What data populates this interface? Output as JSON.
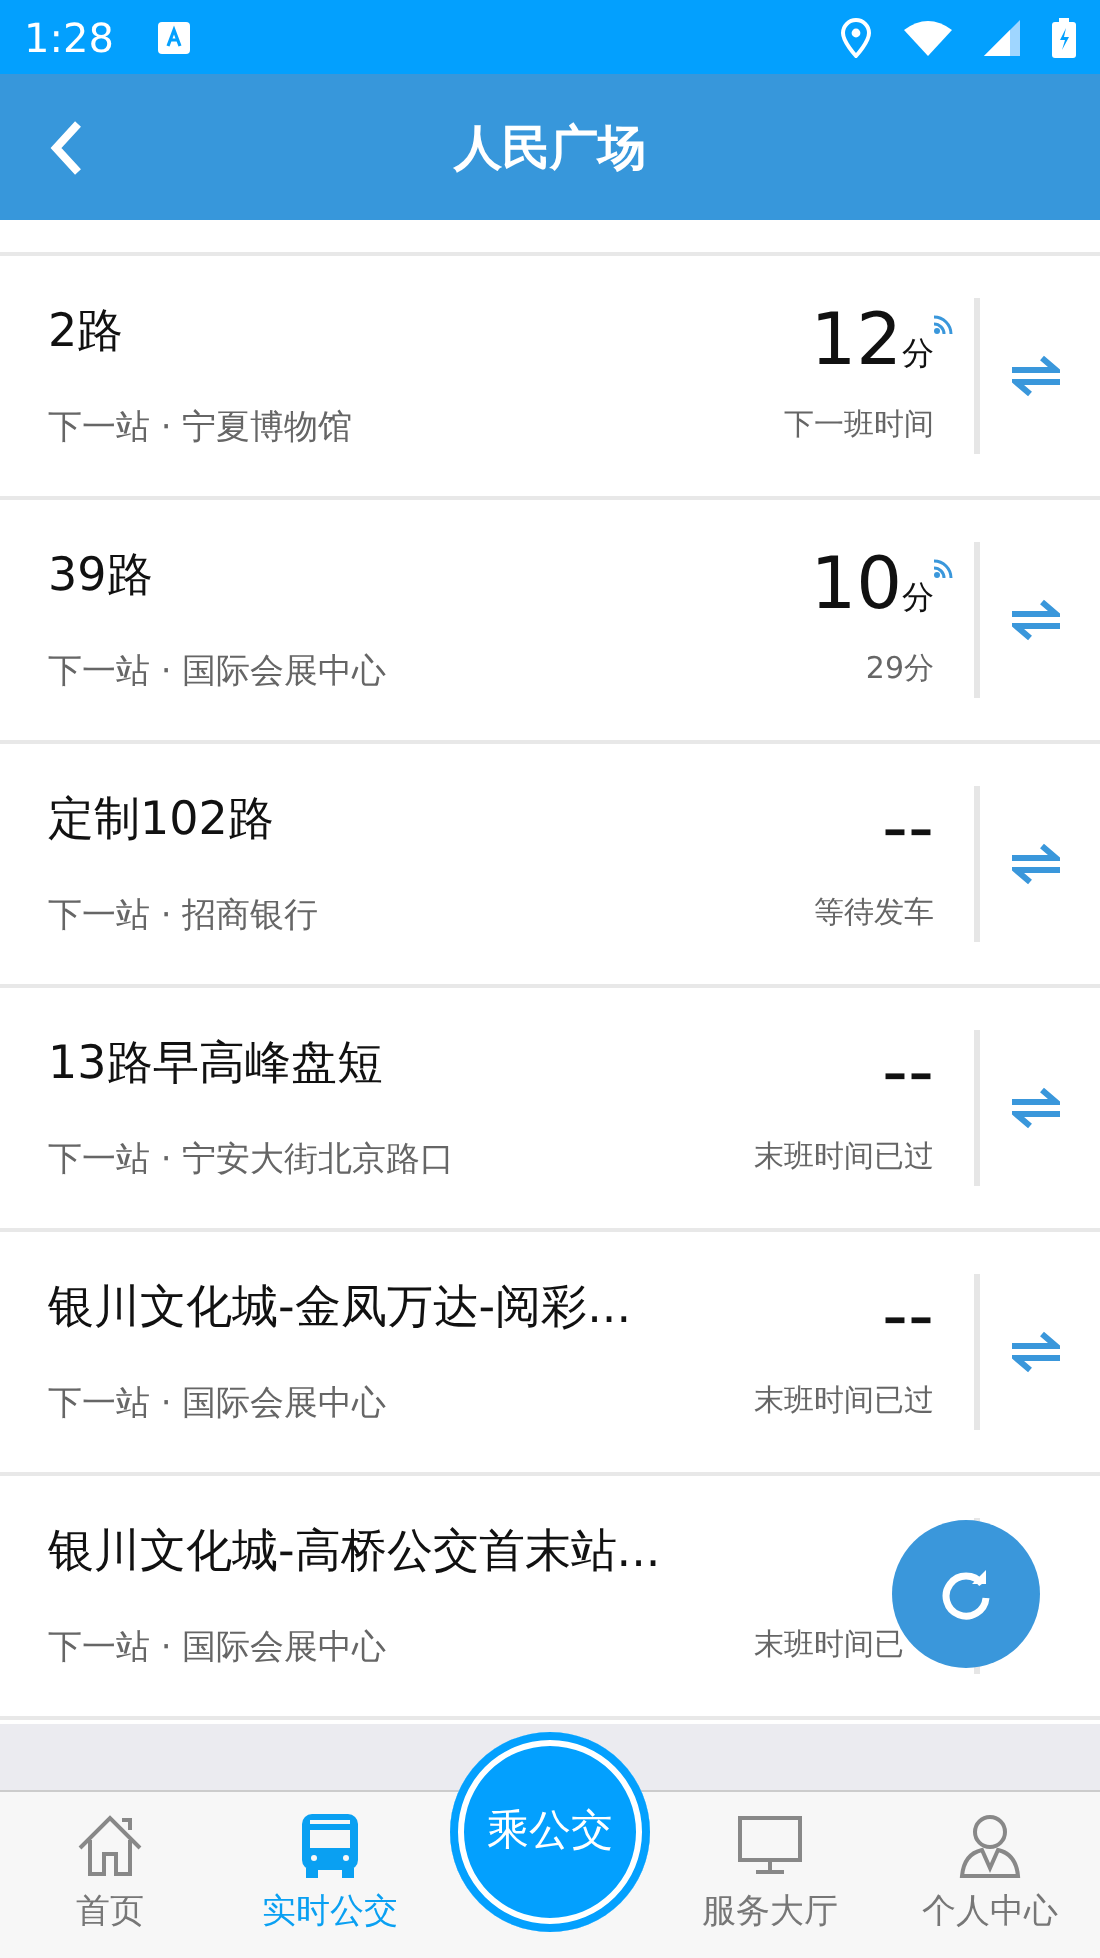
{
  "status_bar": {
    "time": "1:28"
  },
  "header": {
    "title": "人民广场"
  },
  "routes": [
    {
      "route": "2路",
      "next_stop": "下一站 · 宁夏博物馆",
      "eta": "12",
      "eta_unit": "分",
      "realtime": true,
      "status": "下一班时间"
    },
    {
      "route": "39路",
      "next_stop": "下一站 · 国际会展中心",
      "eta": "10",
      "eta_unit": "分",
      "realtime": true,
      "status": "29分"
    },
    {
      "route": "定制102路",
      "next_stop": "下一站 · 招商银行",
      "eta": "--",
      "realtime": false,
      "status": "等待发车"
    },
    {
      "route": "13路早高峰盘短",
      "next_stop": "下一站 · 宁安大街北京路口",
      "eta": "--",
      "realtime": false,
      "status": "末班时间已过"
    },
    {
      "route": "银川文化城-金凤万达-阅彩...",
      "next_stop": "下一站 · 国际会展中心",
      "eta": "--",
      "realtime": false,
      "status": "末班时间已过"
    },
    {
      "route": "银川文化城-高桥公交首末站...",
      "next_stop": "下一站 · 国际会展中心",
      "status": "末班时间已"
    }
  ],
  "nav": [
    {
      "kind": "home",
      "label": "首页",
      "selected": false
    },
    {
      "kind": "bus",
      "label": "实时公交",
      "selected": true
    },
    {
      "kind": "center",
      "label": "乘公交"
    },
    {
      "kind": "monitor",
      "label": "服务大厅",
      "selected": false
    },
    {
      "kind": "person",
      "label": "个人中心",
      "selected": false
    }
  ]
}
